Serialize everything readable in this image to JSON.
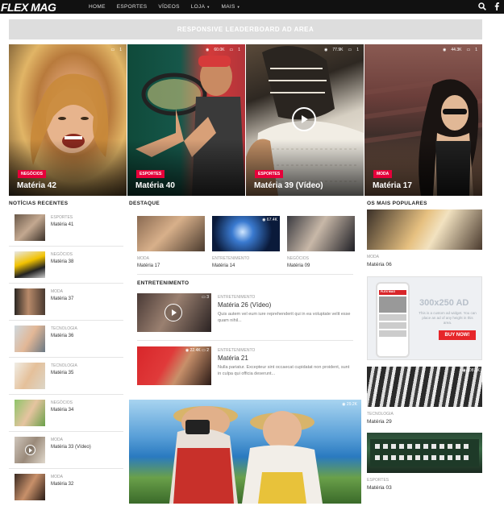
{
  "header": {
    "logo": "FLEX MAG",
    "nav": [
      {
        "label": "HOME",
        "dropdown": false
      },
      {
        "label": "ESPORTES",
        "dropdown": false
      },
      {
        "label": "VÍDEOS",
        "dropdown": false
      },
      {
        "label": "LOJA",
        "dropdown": true
      },
      {
        "label": "MAIS",
        "dropdown": true
      }
    ],
    "icons": [
      "search-icon",
      "facebook-icon"
    ]
  },
  "leaderboard_ad": "RESPONSIVE LEADERBOARD AD AREA",
  "hero": [
    {
      "category": "NEGÓCIOS",
      "title": "Matéria 42",
      "views": "",
      "comments": "1",
      "video": false
    },
    {
      "category": "ESPORTES",
      "title": "Matéria 40",
      "views": "60.0K",
      "comments": "1",
      "video": false
    },
    {
      "category": "ESPORTES",
      "title": "Matéria 39 (Vídeo)",
      "views": "77.9K",
      "comments": "1",
      "video": true
    },
    {
      "category": "MODA",
      "title": "Matéria 17",
      "views": "44.3K",
      "comments": "1",
      "video": false
    }
  ],
  "sections": {
    "recent": "NOTÍCIAS RECENTES",
    "featured": "DESTAQUE",
    "entertainment": "ENTRETENIMENTO",
    "popular": "OS MAIS POPULARES"
  },
  "recent": [
    {
      "category": "ESPORTES",
      "title": "Matéria 41"
    },
    {
      "category": "NEGÓCIOS",
      "title": "Matéria 38"
    },
    {
      "category": "MODA",
      "title": "Matéria 37"
    },
    {
      "category": "TECNOLOGIA",
      "title": "Matéria 36"
    },
    {
      "category": "TECNOLOGIA",
      "title": "Matéria 35"
    },
    {
      "category": "NEGÓCIOS",
      "title": "Matéria 34"
    },
    {
      "category": "MODA",
      "title": "Matéria 33 (Vídeo)"
    },
    {
      "category": "MODA",
      "title": "Matéria 32"
    }
  ],
  "featured": [
    {
      "category": "MODA",
      "title": "Matéria 17",
      "views": ""
    },
    {
      "category": "ENTRETENIMENTO",
      "title": "Matéria 14",
      "views": "67.4K"
    },
    {
      "category": "NEGÓCIOS",
      "title": "Matéria 09",
      "views": ""
    }
  ],
  "entertainment": [
    {
      "category": "ENTRETENIMENTO",
      "title": "Matéria 26 (Vídeo)",
      "excerpt": "Quis autem vel eum iure reprehenderit qui in ea voluptate velit esse quam nihil...",
      "views": "",
      "comments": "3"
    },
    {
      "category": "ENTRETENIMENTO",
      "title": "Matéria 21",
      "excerpt": "Nulla pariatur. Excepteur sint occaecat cupidatat non proident, sunt in culpa qui officia deserunt...",
      "views": "22.4K",
      "comments": "2"
    }
  ],
  "big_feature": {
    "views": "29.2K"
  },
  "popular": [
    {
      "category": "MODA",
      "title": "Matéria 06",
      "views": ""
    },
    {
      "category": "TECNOLOGIA",
      "title": "Matéria 29",
      "views": "308.1K"
    },
    {
      "category": "ESPORTES",
      "title": "Matéria 03",
      "views": ""
    }
  ],
  "square_ad": {
    "headline": "300x250 AD",
    "body": "This is a custom ad widget. You can place an ad of any height in this area.",
    "button": "BUY NOW!",
    "mock_logo": "FLEX MAG"
  },
  "colors": {
    "accent": "#e6003a",
    "topbar": "#111111"
  }
}
